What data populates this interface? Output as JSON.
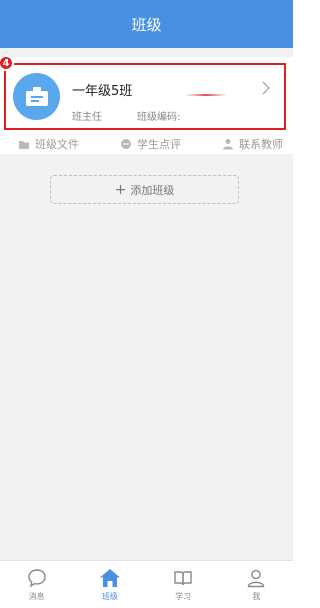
{
  "header": {
    "title": "班级"
  },
  "annotation": {
    "badge": "4"
  },
  "class_card": {
    "name": "一年级5班",
    "teacher_label": "班主任",
    "code_label": "班级编码:"
  },
  "menu": {
    "items": [
      {
        "label": "班级文件",
        "icon": "folder-icon"
      },
      {
        "label": "学生点评",
        "icon": "comment-icon"
      },
      {
        "label": "联系教师",
        "icon": "person-icon"
      }
    ]
  },
  "add_class": {
    "label": "添加班级"
  },
  "tabbar": {
    "items": [
      {
        "label": "消息",
        "icon": "chat-bubble-icon",
        "active": false
      },
      {
        "label": "班级",
        "icon": "home-icon",
        "active": true
      },
      {
        "label": "学习",
        "icon": "book-icon",
        "active": false
      },
      {
        "label": "我",
        "icon": "user-icon",
        "active": false
      }
    ]
  },
  "colors": {
    "primary": "#4a90e2",
    "highlight": "#e02020",
    "avatar": "#5ba7ee",
    "background": "#f2f2f2"
  }
}
